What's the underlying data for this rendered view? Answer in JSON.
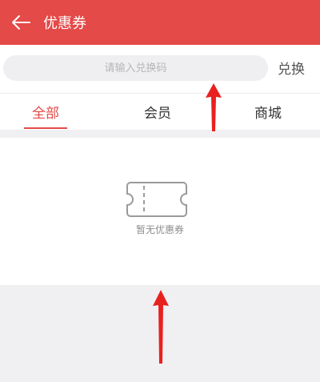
{
  "header": {
    "title": "优惠券",
    "back_icon": "arrow-left-icon",
    "background_color": "#e34a48"
  },
  "redeem": {
    "placeholder": "请输入兑换码",
    "button_label": "兑换"
  },
  "tabs": [
    {
      "label": "全部",
      "active": true
    },
    {
      "label": "会员",
      "active": false
    },
    {
      "label": "商城",
      "active": false
    }
  ],
  "accent_color": "#e34a48",
  "empty_state": {
    "icon": "ticket-icon",
    "text": "暂无优惠券"
  },
  "annotations": {
    "arrow_icon": "red-up-arrow-icon",
    "arrow_color": "#e8211f"
  }
}
